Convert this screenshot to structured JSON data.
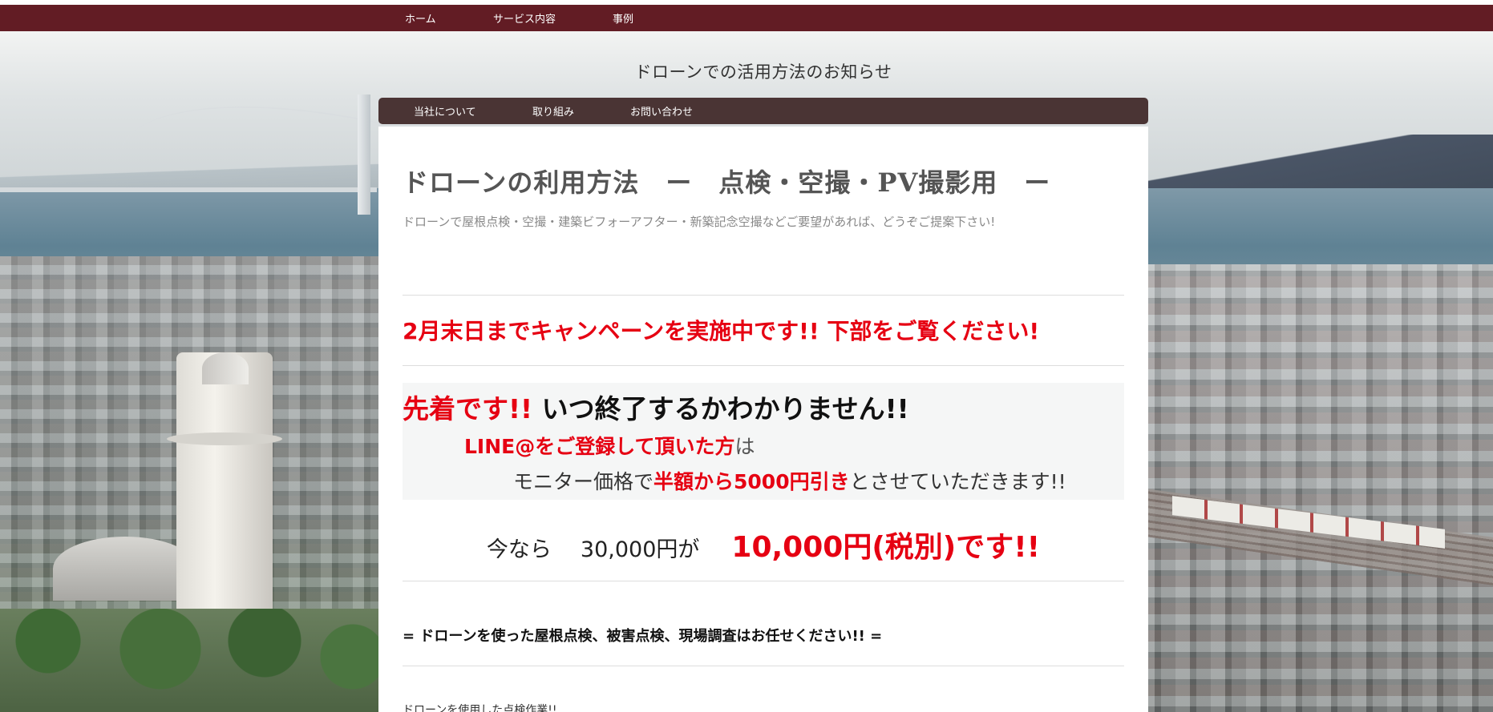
{
  "top_nav": {
    "items": [
      "ホーム",
      "サービス内容",
      "事例"
    ]
  },
  "site": {
    "title": "ドローンでの活用方法のお知らせ"
  },
  "sub_nav": {
    "items": [
      "当社について",
      "取り組み",
      "お問い合わせ"
    ]
  },
  "main": {
    "title": "ドローンの利用方法　ー　点検・空撮・PV撮影用　ー",
    "description": "ドローンで屋根点検・空撮・建築ビフォーアフター・新築記念空撮などご要望があれば、どうぞご提案下さい!",
    "campaign": "2月末日までキャンペーンを実施中です!! 下部をご覧ください!",
    "promo": {
      "line1_red": "先着です!!",
      "line1_black": " いつ終了するかわかりません!!",
      "line2_bold": "LINE@をご登録して頂いた方",
      "line2_normal": "は",
      "line3_pre": "モニター価格で",
      "line3_bold": "半額から5000円引き",
      "line3_post": "とさせていただきます!!"
    },
    "price": {
      "prefix": "今なら",
      "original": "30,000円が",
      "sale": "10,000円(税別)です!!"
    },
    "service_heading": "= ドローンを使った屋根点検、被害点検、現場調査はお任せください!! =",
    "work_note": "ドローンを使用した点検作業!!"
  },
  "colors": {
    "top_nav_bg": "#621c24",
    "sub_nav_bg": "#4a3434",
    "accent_red": "#e60012"
  }
}
